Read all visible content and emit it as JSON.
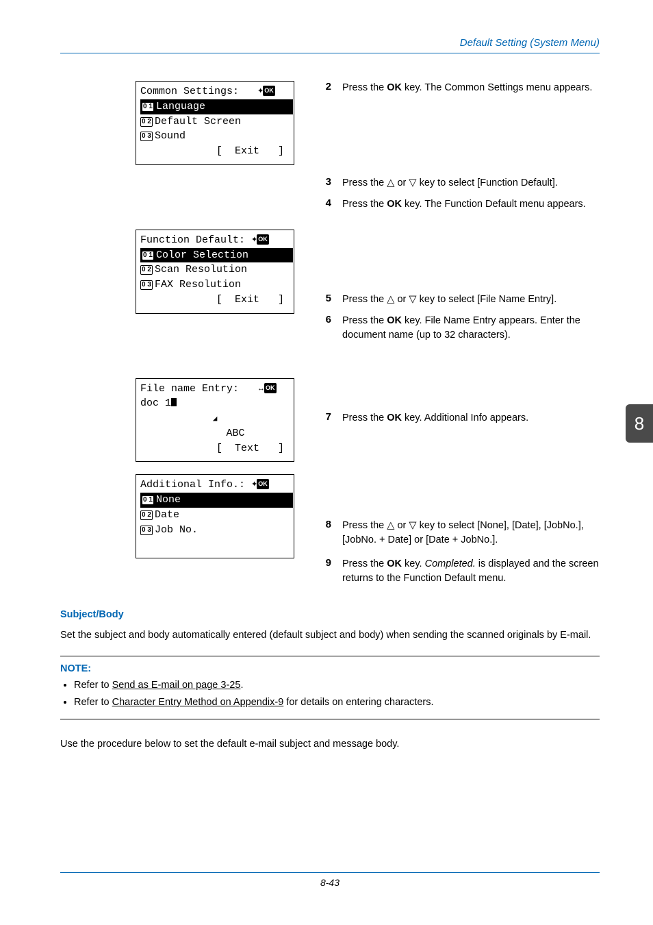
{
  "header": {
    "title": "Default Setting (System Menu)"
  },
  "side_tab": "8",
  "lcd1": {
    "title": "Common Settings:",
    "items": [
      {
        "num": "0 1",
        "label": "Language",
        "selected": true
      },
      {
        "num": "0 2",
        "label": "Default Screen",
        "selected": false
      },
      {
        "num": "0 3",
        "label": "Sound",
        "selected": false
      }
    ],
    "softkey": "[  Exit   ]"
  },
  "lcd2": {
    "title": "Function Default:",
    "items": [
      {
        "num": "0 1",
        "label": "Color Selection",
        "selected": true
      },
      {
        "num": "0 2",
        "label": "Scan Resolution",
        "selected": false
      },
      {
        "num": "0 3",
        "label": "FAX Resolution",
        "selected": false
      }
    ],
    "softkey": "[  Exit   ]"
  },
  "lcd3": {
    "title": "File name Entry:",
    "value": "doc 1",
    "mode": "ABC",
    "softkey": "[  Text   ]"
  },
  "lcd4": {
    "title": "Additional Info.:",
    "items": [
      {
        "num": "0 1",
        "label": "None",
        "selected": true
      },
      {
        "num": "0 2",
        "label": "Date",
        "selected": false
      },
      {
        "num": "0 3",
        "label": "Job No.",
        "selected": false
      }
    ]
  },
  "steps": {
    "s2": {
      "num": "2",
      "pre": "Press the ",
      "key": "OK",
      "post": " key. The Common Settings menu appears."
    },
    "s3": {
      "num": "3",
      "text_a": "Press the ",
      "text_b": " or ",
      "text_c": " key to select [Function Default]."
    },
    "s4": {
      "num": "4",
      "pre": "Press the ",
      "key": "OK",
      "post": " key. The Function Default menu appears."
    },
    "s5": {
      "num": "5",
      "text_a": "Press the ",
      "text_b": " or ",
      "text_c": " key to select [File Name Entry]."
    },
    "s6": {
      "num": "6",
      "pre": "Press the ",
      "key": "OK",
      "post": " key. File Name Entry appears. Enter the document name (up to 32 characters)."
    },
    "s7": {
      "num": "7",
      "pre": "Press the ",
      "key": "OK",
      "post": " key. Additional Info appears."
    },
    "s8": {
      "num": "8",
      "text_a": "Press the ",
      "text_b": " or ",
      "text_c": " key to select [None], [Date], [JobNo.], [JobNo. + Date] or [Date + JobNo.]."
    },
    "s9": {
      "num": "9",
      "pre": "Press the ",
      "key": "OK",
      "mid2": " key. ",
      "ital": "Completed.",
      "post2": " is displayed and the screen returns to the Function Default menu."
    }
  },
  "section": {
    "heading": "Subject/Body",
    "body": "Set the subject and body automatically entered (default subject and body) when sending the scanned originals by E-mail."
  },
  "note": {
    "label": "NOTE:",
    "b1a": "Refer to ",
    "b1link": "Send as E-mail on page 3-25",
    "b1b": ".",
    "b2a": "Refer to ",
    "b2link": "Character Entry Method on Appendix-9",
    "b2b": " for details on entering characters."
  },
  "para2": "Use the procedure below to set the default e-mail subject and message body.",
  "footer": "8-43"
}
